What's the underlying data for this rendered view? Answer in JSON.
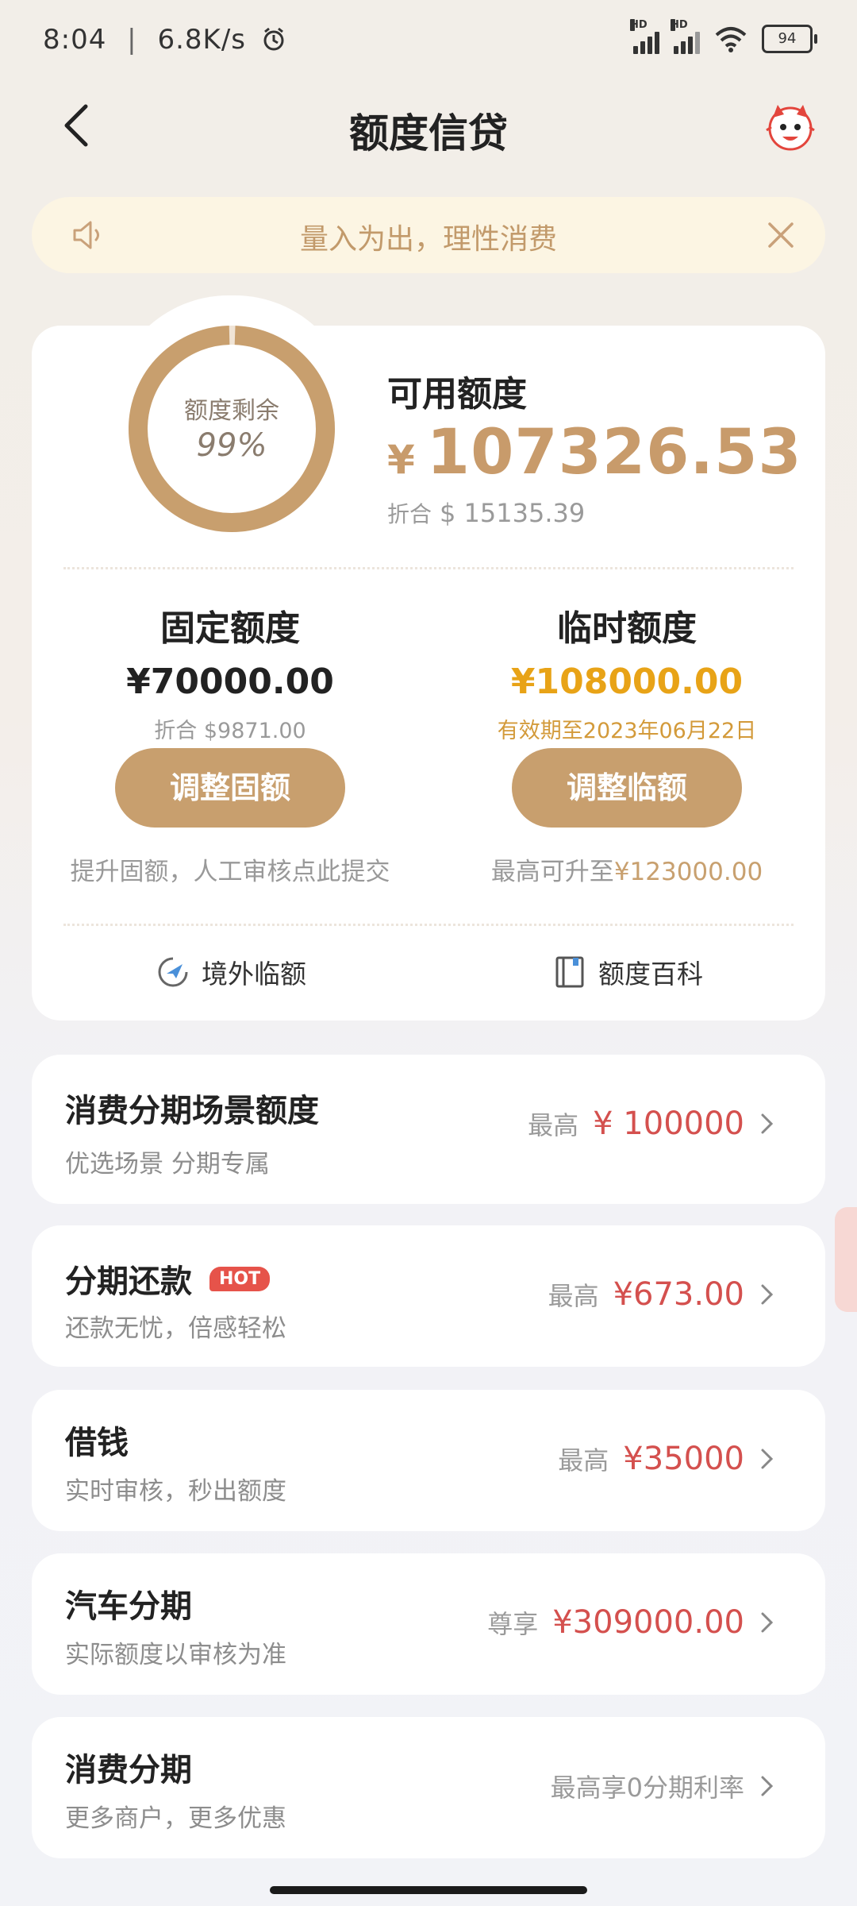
{
  "status_bar": {
    "time": "8:04",
    "speed": "6.8K/s",
    "battery": "94",
    "network1": "HD",
    "network2": "HD"
  },
  "header": {
    "title": "额度信贷"
  },
  "notice": {
    "text": "量入为出，理性消费"
  },
  "credit": {
    "ring_label": "额度剩余",
    "ring_percent": "99%",
    "ring_fraction": 0.99,
    "available_title": "可用额度",
    "available_currency": "¥",
    "available_amount": "107326.53",
    "available_usd_prefix": "折合",
    "available_usd": "$ 15135.39"
  },
  "fixed": {
    "title": "固定额度",
    "amount": "¥70000.00",
    "sub": "折合 $9871.00",
    "button": "调整固额",
    "hint": "提升固额，人工审核点此提交"
  },
  "temporary": {
    "title": "临时额度",
    "amount": "¥108000.00",
    "sub": "有效期至2023年06月22日",
    "button": "调整临额",
    "hint_prefix": "最高可升至",
    "hint_amount": "¥123000.00"
  },
  "quick_links": [
    {
      "label": "境外临额",
      "icon": "plane-icon"
    },
    {
      "label": "额度百科",
      "icon": "book-icon"
    }
  ],
  "items": [
    {
      "title": "消费分期场景额度",
      "sub": "优选场景  分期专属",
      "prefix": "最高",
      "amount": "¥ 100000"
    },
    {
      "title": "分期还款",
      "badge": "HOT",
      "sub": "还款无忧，倍感轻松",
      "prefix": "最高",
      "amount": "¥673.00"
    },
    {
      "title": "借钱",
      "sub": "实时审核，秒出额度",
      "prefix": "最高",
      "amount": "¥35000"
    },
    {
      "title": "汽车分期",
      "sub": "实际额度以审核为准",
      "prefix": "尊享",
      "amount": "¥309000.00"
    },
    {
      "title": "消费分期",
      "sub": "更多商户，更多优惠",
      "prefix": "最高享0分期利率",
      "amount": ""
    }
  ],
  "colors": {
    "gold": "#c89f6e",
    "red": "#d4504e",
    "amber": "#e8a317"
  }
}
